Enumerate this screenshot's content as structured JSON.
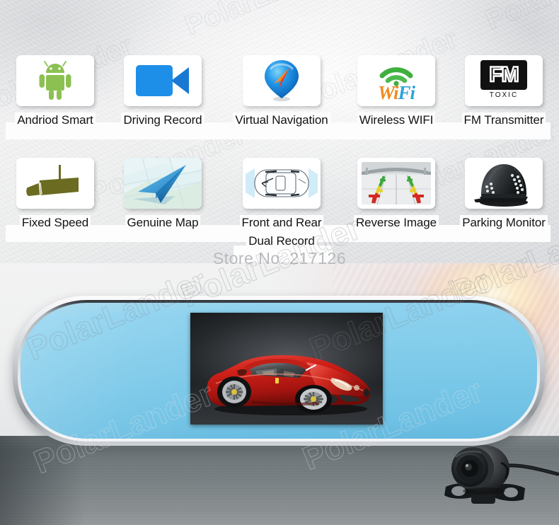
{
  "page": {
    "store_watermark": "Store No. 217126",
    "brand_watermark": "PolarLander"
  },
  "colors": {
    "android_green": "#8cc152",
    "video_blue": "#1e8fe8",
    "pin_blue": "#1e8fe8",
    "pin_arrow_red": "#e8402a",
    "wifi_green": "#3faf3f",
    "wifi_orange": "#f08a1e",
    "wifi_blue": "#2ea3dd",
    "fm_black": "#111111",
    "speed_olive": "#6b6b22",
    "plane_blue": "#2b8fd8",
    "mirror_glass": "#7cc9e9",
    "mirror_frame": "#b9bdc2",
    "road_grey": "#7e8689",
    "guide_green": "#39a83a",
    "guide_yellow": "#e8cf22",
    "guide_red": "#d32a22",
    "car_red": "#c4221c"
  },
  "features": {
    "row1": [
      {
        "label": "Andriod Smart",
        "icon": "android-robot-icon"
      },
      {
        "label": "Driving Record",
        "icon": "video-camera-icon"
      },
      {
        "label": "Virtual Navigation",
        "icon": "map-pin-navigation-icon"
      },
      {
        "label": "Wireless WIFI",
        "icon": "wifi-icon"
      },
      {
        "label": "FM Transmitter",
        "icon": "fm-transmitter-icon"
      }
    ],
    "row2": [
      {
        "label": "Fixed Speed",
        "icon": "speed-camera-icon"
      },
      {
        "label": "Genuine Map",
        "icon": "paper-plane-map-icon"
      },
      {
        "label": "Front and Rear",
        "label2": "Dual Record",
        "icon": "car-top-view-icon"
      },
      {
        "label": "Reverse Image",
        "icon": "reverse-camera-view-icon"
      },
      {
        "label": "Parking Monitor",
        "icon": "dome-camera-icon"
      }
    ]
  },
  "wifi_icon": {
    "wi": "Wi",
    "fi": "Fi"
  },
  "fm_icon": {
    "letters": "FM",
    "sub": "TOXIC"
  },
  "product": {
    "mirror_name": "rearview-mirror-dashcam",
    "screen_content": "red-sports-car-preview",
    "backup_camera": "rear-backup-camera"
  }
}
